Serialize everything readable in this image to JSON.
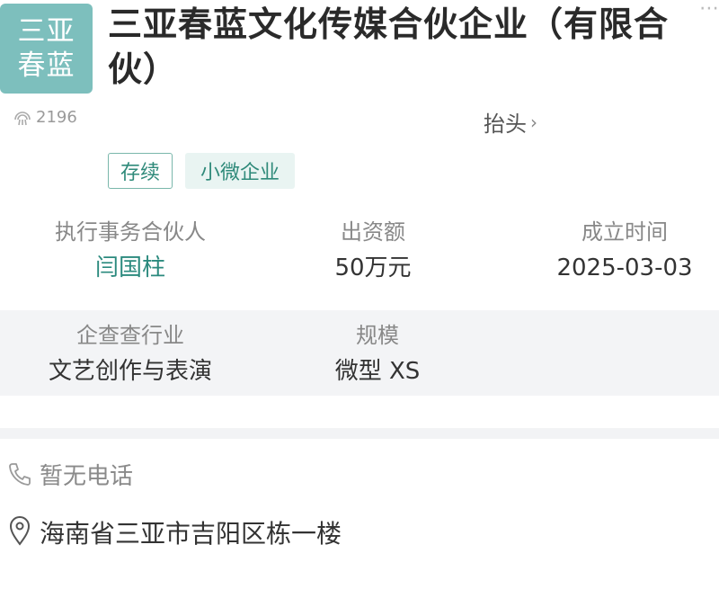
{
  "company": {
    "logo_lines": [
      "三亚",
      "春蓝"
    ],
    "name": "三亚春蓝文化传媒合伙企业（有限合伙）"
  },
  "header": {
    "views": "2196",
    "taitou_label": "抬头",
    "chevron": "›"
  },
  "tags": {
    "status": "存续",
    "scale": "小微企业"
  },
  "info": {
    "partner_label": "执行事务合伙人",
    "partner_value": "闫国柱",
    "capital_label": "出资额",
    "capital_value": "50万元",
    "founded_label": "成立时间",
    "founded_value": "2025-03-03",
    "industry_label": "企查查行业",
    "industry_value": "文艺创作与表演",
    "size_label": "规模",
    "size_value": "微型 XS"
  },
  "contact": {
    "phone": "暂无电话",
    "address": "海南省三亚市吉阳区栋一楼"
  },
  "colors": {
    "accent": "#2b8a7e",
    "logo_bg": "#7dbfbd",
    "band_bg": "#f3f4f6"
  }
}
